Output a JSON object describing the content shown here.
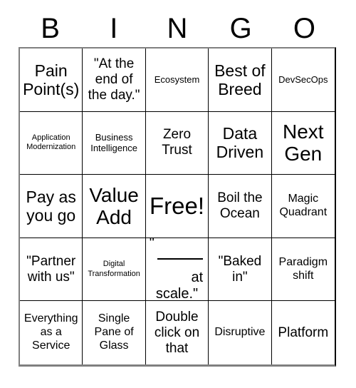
{
  "card": {
    "header_letters": [
      "B",
      "I",
      "N",
      "G",
      "O"
    ],
    "columns": 5,
    "rows": 5,
    "colors": {
      "background": "#ffffff",
      "text": "#000000",
      "grid_line": "#000000",
      "outer_border": "#808080"
    },
    "squares": [
      {
        "id": "b1",
        "text": "Pain Point(s)",
        "size": "xl"
      },
      {
        "id": "i1",
        "text": "\"At the end of the day.\"",
        "size": "lg"
      },
      {
        "id": "n1",
        "text": "Ecosystem",
        "size": "sm"
      },
      {
        "id": "g1",
        "text": "Best of Breed",
        "size": "xl"
      },
      {
        "id": "o1",
        "text": "DevSecOps",
        "size": "sm"
      },
      {
        "id": "b2",
        "text": "Application Modernization",
        "size": "xs"
      },
      {
        "id": "i2",
        "text": "Business Intelligence",
        "size": "sm"
      },
      {
        "id": "n2",
        "text": "Zero Trust",
        "size": "lg"
      },
      {
        "id": "g2",
        "text": "Data Driven",
        "size": "xl"
      },
      {
        "id": "o2",
        "text": "Next Gen",
        "size": "xxl"
      },
      {
        "id": "b3",
        "text": "Pay as you go",
        "size": "xl"
      },
      {
        "id": "i3",
        "text": "Value Add",
        "size": "xxl"
      },
      {
        "id": "n3",
        "text": "Free!",
        "size": "huge",
        "free_space": true
      },
      {
        "id": "g3",
        "text": "Boil the Ocean",
        "size": "lg"
      },
      {
        "id": "o3",
        "text": "Magic Quadrant",
        "size": "md"
      },
      {
        "id": "b4",
        "text": "\"Partner with us\"",
        "size": "lg"
      },
      {
        "id": "i4",
        "text": "Digital Transformation",
        "size": "xs"
      },
      {
        "id": "n4",
        "text": "\"____ at scale.\"",
        "size": "lg",
        "fill_in_blank": true,
        "parts": {
          "open_quote": "\"",
          "after_blank": "at",
          "last_line": "scale.\""
        }
      },
      {
        "id": "g4",
        "text": "\"Baked in\"",
        "size": "lg"
      },
      {
        "id": "o4",
        "text": "Paradigm shift",
        "size": "md"
      },
      {
        "id": "b5",
        "text": "Everything as a Service",
        "size": "md"
      },
      {
        "id": "i5",
        "text": "Single Pane of Glass",
        "size": "md"
      },
      {
        "id": "n5",
        "text": "Double click on that",
        "size": "lg"
      },
      {
        "id": "g5",
        "text": "Disruptive",
        "size": "md"
      },
      {
        "id": "o5",
        "text": "Platform",
        "size": "lg"
      }
    ]
  }
}
